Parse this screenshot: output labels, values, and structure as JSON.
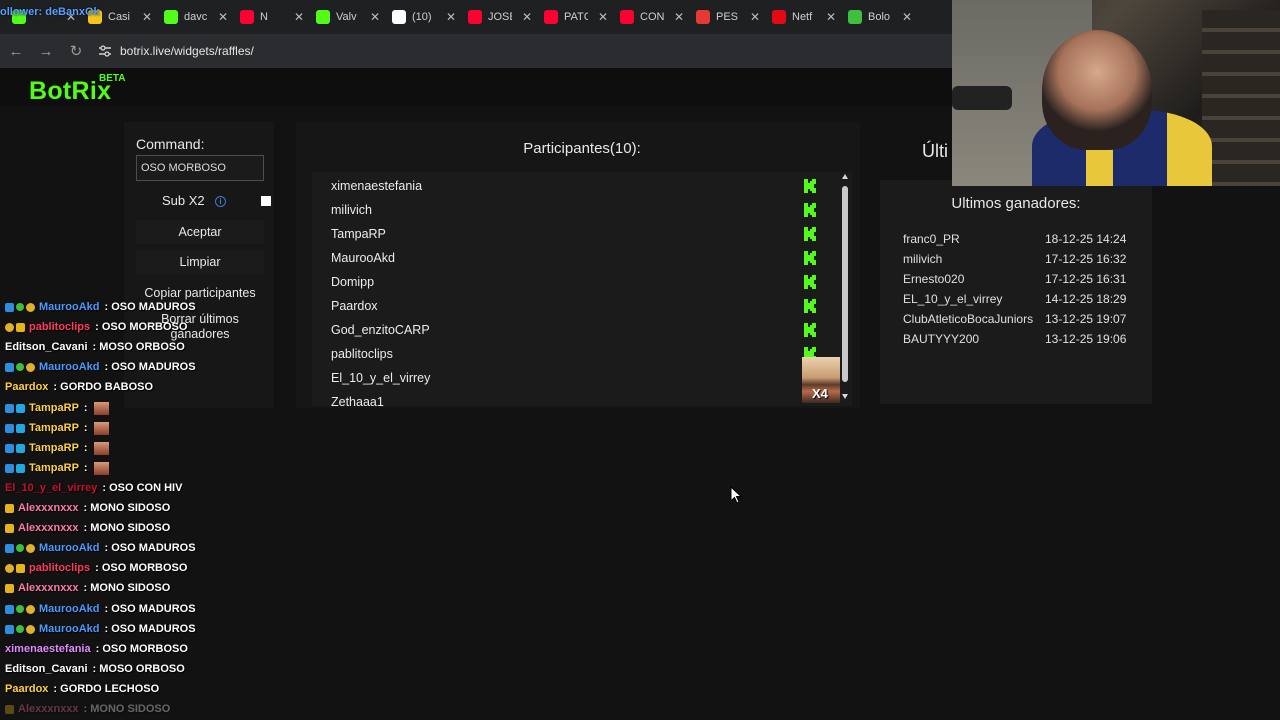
{
  "browser": {
    "overlay_handle": "ollower: deBanxOk",
    "tabs": [
      {
        "label": "",
        "color": "#53fc18"
      },
      {
        "label": "Casi",
        "color": "#f5c518"
      },
      {
        "label": "davc",
        "color": "#53fc18"
      },
      {
        "label": "N",
        "color": "#ff0033"
      },
      {
        "label": "Valv",
        "color": "#53fc18"
      },
      {
        "label": "(10)",
        "color": "#ffffff"
      },
      {
        "label": "JOSE",
        "color": "#ff0033"
      },
      {
        "label": "PATC",
        "color": "#ff0033"
      },
      {
        "label": "CON",
        "color": "#ff0033"
      },
      {
        "label": "PES",
        "color": "#e53935"
      },
      {
        "label": "Netf",
        "color": "#e50914"
      },
      {
        "label": "Bolo",
        "color": "#3ec03e"
      }
    ],
    "url": "botrix.live/widgets/raffles/"
  },
  "site": {
    "logo": "BotRix",
    "beta": "BETA"
  },
  "left_panel": {
    "command_label": "Command:",
    "command_value": "OSO MORBOSO",
    "sub_label": "Sub X2",
    "info_icon": "i",
    "accept": "Aceptar",
    "clear": "Limpiar",
    "copy": "Copiar participantes",
    "delete_line1": "Borrar últimos",
    "delete_line2": "ganadores"
  },
  "participants": {
    "title": "Participantes(10):",
    "names": [
      "ximenaestefania",
      "milivich",
      "TampaRP",
      "MaurooAkd",
      "Domipp",
      "Paardox",
      "God_enzitoCARP",
      "pablitoclips",
      "El_10_y_el_virrey",
      "Zethaaa1"
    ],
    "emote_badge": "X4",
    "kick_color": "#53fc18"
  },
  "winners": {
    "title_cut": "Últi",
    "title": "Ultimos ganadores:",
    "rows": [
      {
        "name": "franc0_PR",
        "date": "18-12-25 14:24"
      },
      {
        "name": "milivich",
        "date": "17-12-25 16:32"
      },
      {
        "name": "Ernesto020",
        "date": "17-12-25 16:31"
      },
      {
        "name": "EL_10_y_el_virrey",
        "date": "14-12-25 18:29"
      },
      {
        "name": "ClubAtleticoBocaJuniors",
        "date": "13-12-25 19:07"
      },
      {
        "name": "BAUTYYY200",
        "date": "13-12-25 19:06"
      }
    ]
  },
  "chat": [
    {
      "badges": [
        "blue",
        "green",
        "gold"
      ],
      "user": "MaurooAkd",
      "color": "#4a9bff",
      "msg": ": OSO MADUROS"
    },
    {
      "badges": [
        "gold",
        "yellow"
      ],
      "user": "pablitoclips",
      "color": "#ff3b5c",
      "msg": ": OSO MORBOSO"
    },
    {
      "badges": [],
      "user": "Editson_Cavani",
      "color": "#ffffff",
      "msg": ": MOSO ORBOSO"
    },
    {
      "badges": [
        "blue",
        "green",
        "gold"
      ],
      "user": "MaurooAkd",
      "color": "#4a9bff",
      "msg": ": OSO MADUROS"
    },
    {
      "badges": [],
      "user": "Paardox",
      "color": "#ffd23f",
      "msg": ": GORDO BABOSO"
    },
    {
      "badges": [
        "blue",
        "cyan"
      ],
      "user": "TampaRP",
      "color": "#ffd23f",
      "msg": ":",
      "emote": true
    },
    {
      "badges": [
        "blue",
        "cyan"
      ],
      "user": "TampaRP",
      "color": "#ffd23f",
      "msg": ":",
      "emote": true
    },
    {
      "badges": [
        "blue",
        "cyan"
      ],
      "user": "TampaRP",
      "color": "#ffd23f",
      "msg": ":",
      "emote": true
    },
    {
      "badges": [
        "blue",
        "cyan"
      ],
      "user": "TampaRP",
      "color": "#ffd23f",
      "msg": ":",
      "emote": true
    },
    {
      "badges": [],
      "user": "El_10_y_el_virrey",
      "color": "#c8102e",
      "msg": ": OSO CON HIV"
    },
    {
      "badges": [
        "yellow"
      ],
      "user": "Alexxxnxxx",
      "color": "#ff7aa8",
      "msg": ": MONO SIDOSO"
    },
    {
      "badges": [
        "yellow"
      ],
      "user": "Alexxxnxxx",
      "color": "#ff7aa8",
      "msg": ": MONO SIDOSO"
    },
    {
      "badges": [
        "blue",
        "green",
        "gold"
      ],
      "user": "MaurooAkd",
      "color": "#4a9bff",
      "msg": ": OSO MADUROS"
    },
    {
      "badges": [
        "gold",
        "yellow"
      ],
      "user": "pablitoclips",
      "color": "#ff3b5c",
      "msg": ": OSO MORBOSO"
    },
    {
      "badges": [
        "yellow"
      ],
      "user": "Alexxxnxxx",
      "color": "#ff7aa8",
      "msg": ": MONO SIDOSO"
    },
    {
      "badges": [
        "blue",
        "green",
        "gold"
      ],
      "user": "MaurooAkd",
      "color": "#4a9bff",
      "msg": ": OSO MADUROS"
    },
    {
      "badges": [
        "blue",
        "green",
        "gold"
      ],
      "user": "MaurooAkd",
      "color": "#4a9bff",
      "msg": ": OSO MADUROS"
    },
    {
      "badges": [],
      "user": "ximenaestefania",
      "color": "#e38cff",
      "msg": ": OSO MORBOSO"
    },
    {
      "badges": [],
      "user": "Editson_Cavani",
      "color": "#ffffff",
      "msg": ": MOSO ORBOSO"
    },
    {
      "badges": [],
      "user": "Paardox",
      "color": "#ffd23f",
      "msg": ": GORDO LECHOSO"
    },
    {
      "badges": [
        "yellow"
      ],
      "user": "Alexxxnxxx",
      "color": "#ff7aa8",
      "msg": ": MONO SIDOSO",
      "fade": true
    }
  ]
}
